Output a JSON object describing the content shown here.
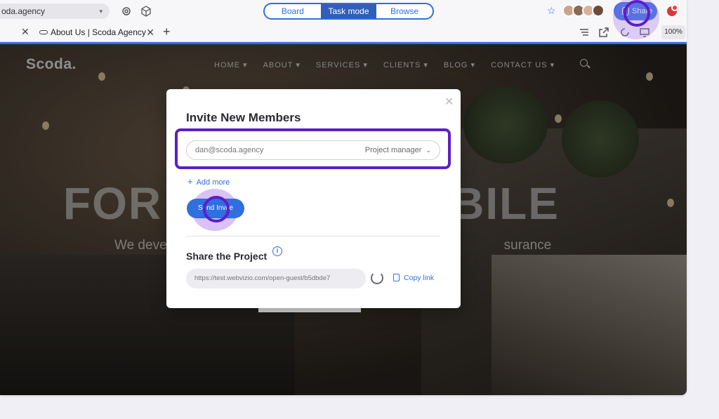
{
  "toolbar": {
    "url": "oda.agency",
    "modes": [
      "Board",
      "Task mode",
      "Browse"
    ],
    "active_mode": "Task mode",
    "share_label": "Share"
  },
  "tabs": {
    "active_tab": "About Us | Scoda Agency",
    "zoom": "100%"
  },
  "site": {
    "logo": "Scoda.",
    "nav": [
      "HOME",
      "ABOUT",
      "SERVICES",
      "CLIENTS",
      "BLOG",
      "CONTACT US"
    ],
    "hero_left": "FOR",
    "hero_right": "BILE",
    "sub_left": "We deve",
    "sub_right": "surance"
  },
  "modal": {
    "title": "Invite New Members",
    "email_placeholder": "dan@scoda.agency",
    "role": "Project manager",
    "add_more": "Add more",
    "send_invite": "Send Invite",
    "share_title": "Share the Project",
    "share_link": "https://test.webvizio.com/open-guest/b5dbde7",
    "copy_link": "Copy link"
  },
  "colors": {
    "accent": "#2f6fe0",
    "highlight": "#5c1ec8"
  }
}
